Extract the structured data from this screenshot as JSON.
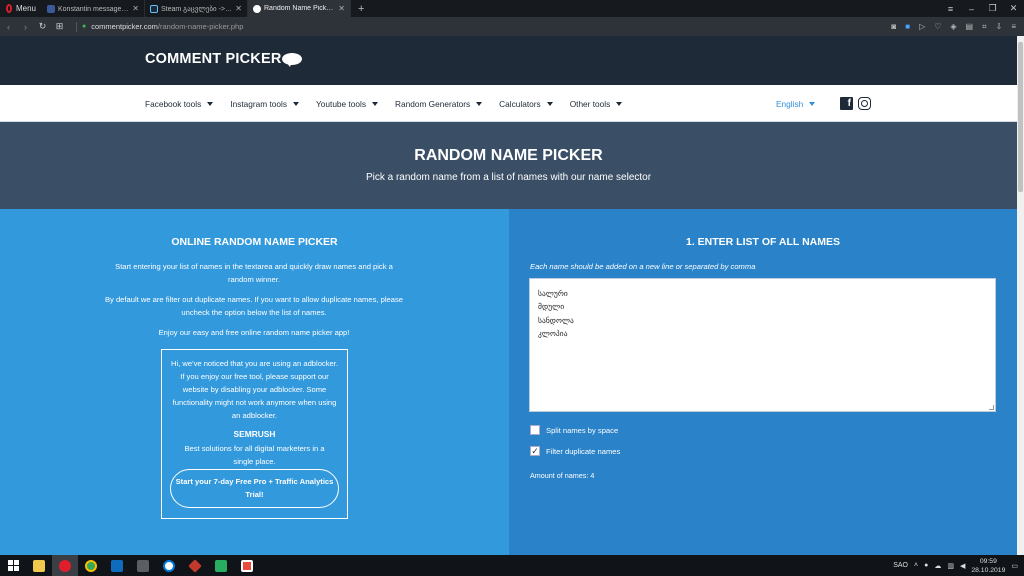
{
  "browser": {
    "menu_label": "Menu",
    "tabs": [
      {
        "title": "Konstantin messaged ათ",
        "icon": "facebook-icon",
        "color": "#3b5998",
        "active": false
      },
      {
        "title": "Steam გაცვლები -> თბ",
        "icon": "steam-icon",
        "color": "#1b2838",
        "active": false
      },
      {
        "title": "Random Name Picker - Pi",
        "icon": "comment-bubble-icon",
        "color": "#ffffff",
        "active": true
      }
    ],
    "new_tab_glyph": "+",
    "url_domain": "commentpicker.com",
    "url_path": "/random-name-picker.php"
  },
  "site": {
    "logo_text": "COMMENT PICKER",
    "nav": [
      {
        "label": "Facebook tools"
      },
      {
        "label": "Instagram tools"
      },
      {
        "label": "Youtube tools"
      },
      {
        "label": "Random Generators"
      },
      {
        "label": "Calculators"
      },
      {
        "label": "Other tools"
      }
    ],
    "language": "English"
  },
  "hero": {
    "title": "RANDOM NAME PICKER",
    "subtitle": "Pick a random name from a list of names with our name selector"
  },
  "left": {
    "title": "ONLINE RANDOM NAME PICKER",
    "p1": "Start entering your list of names in the textarea and quickly draw names and pick a random winner.",
    "p2": "By default we are filter out duplicate names. If you want to allow duplicate names, please uncheck the option below the list of names.",
    "p3": "Enjoy our easy and free online random name picker app!",
    "ad_text": "Hi, we've noticed that you are using an adblocker. If you enjoy our free tool, please support our website by disabling your adblocker. Some functionality might not work anymore when using an adblocker.",
    "semrush_title": "SEMRUSH",
    "semrush_sub": "Best solutions for all digital marketers in a single place.",
    "trial_button": "Start your 7-day Free Pro + Traffic Analytics Trial!"
  },
  "right": {
    "title": "1. ENTER LIST OF ALL NAMES",
    "hint": "Each name should be added on a new line or separated by comma",
    "names": [
      "სალური",
      "მდული",
      "სანდოლა",
      "კლოპია"
    ],
    "split_label": "Split names by space",
    "split_checked": false,
    "filter_label": "Filter duplicate names",
    "filter_checked": true,
    "check_glyph": "✓",
    "amount_label": "Amount of names: 4"
  },
  "taskbar": {
    "tray_lang": "SAO",
    "time": "09:59",
    "date": "28.10.2019"
  },
  "colors": {
    "header": "#1e2a38",
    "hero": "#3a4f66",
    "left_panel": "#3399dd",
    "right_panel": "#2a82c9",
    "accent_link": "#2f8fdb"
  }
}
